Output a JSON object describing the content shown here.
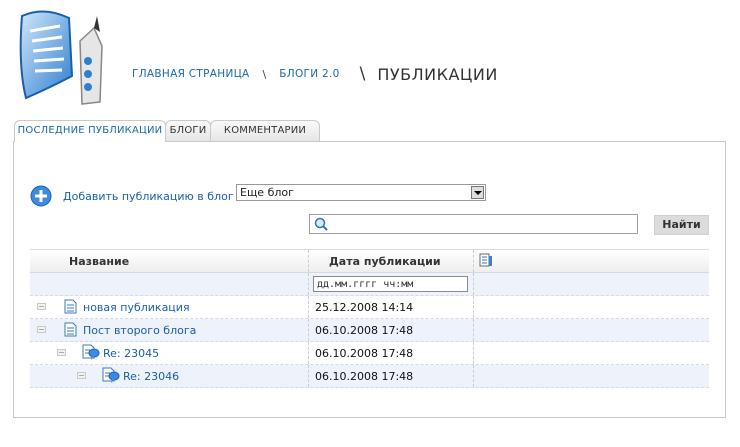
{
  "breadcrumb": {
    "home": "ГЛАВНАЯ СТРАНИЦА",
    "sep": "\\",
    "blogs": "БЛОГИ 2.0",
    "current": "ПУБЛИКАЦИИ"
  },
  "tabs": [
    {
      "label": "ПОСЛЕДНИЕ ПУБЛИКАЦИИ",
      "active": true
    },
    {
      "label": "БЛОГИ",
      "active": false
    },
    {
      "label": "КОММЕНТАРИИ",
      "active": false
    }
  ],
  "toolbar": {
    "add_label": "Добавить публикацию в блог",
    "blog_selected": "Еще блог"
  },
  "search": {
    "value": "",
    "button_label": "Найти"
  },
  "grid": {
    "col_title": "Название",
    "col_date": "Дата публикации",
    "date_filter_value": "дд.мм.гггг чч:мм",
    "rows": [
      {
        "title": "новая публикация",
        "date": "25.12.2008 14:14",
        "level": 0,
        "type": "post"
      },
      {
        "title": "Пост второго блога",
        "date": "06.10.2008 17:48",
        "level": 0,
        "type": "post"
      },
      {
        "title": "Re: 23045",
        "date": "06.10.2008 17:48",
        "level": 1,
        "type": "reply"
      },
      {
        "title": "Re: 23046",
        "date": "06.10.2008 17:48",
        "level": 2,
        "type": "reply"
      }
    ]
  },
  "colors": {
    "link": "#1a5fa8",
    "alt_row": "#eef2fb"
  }
}
